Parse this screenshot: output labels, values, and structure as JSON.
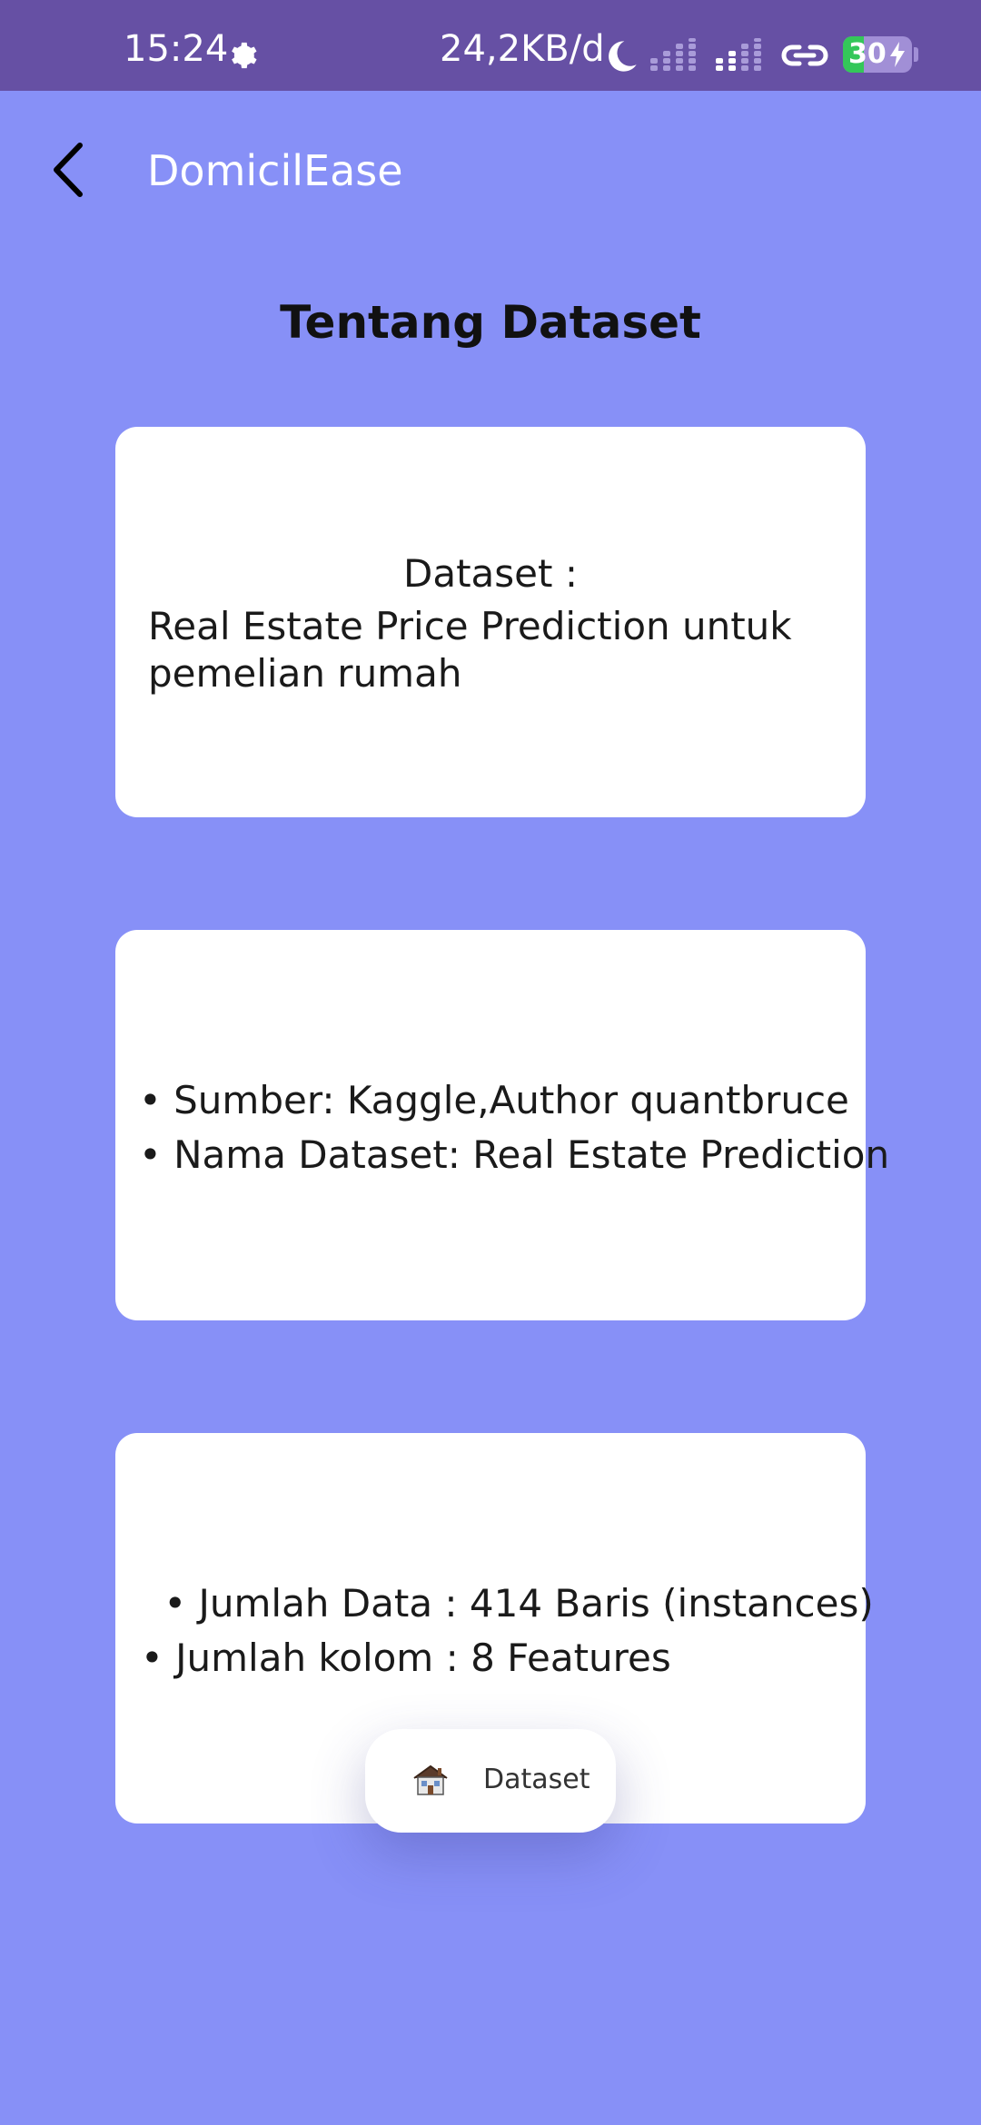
{
  "status_bar": {
    "time": "15:24",
    "net_speed": "24,2KB/d",
    "battery_level": "30",
    "battery_fraction": 0.3,
    "icons": [
      "gear-icon",
      "moon-icon",
      "signal-icon",
      "signal-icon",
      "link-icon",
      "battery-icon",
      "charging-icon"
    ],
    "background": "#6650A4"
  },
  "app_bar": {
    "title": "DomicilEase",
    "back_icon": "chevron-left-icon"
  },
  "page": {
    "title": "Tentang Dataset",
    "background": "#8790F7"
  },
  "cards": [
    {
      "heading": "Dataset :",
      "body": "Real Estate Price Prediction untuk pemelian rumah"
    },
    {
      "lines": [
        "• Sumber: Kaggle,Author quantbruce",
        "• Nama Dataset: Real Estate Prediction"
      ]
    },
    {
      "lines": [
        " • Jumlah Data : 414 Baris (instances)",
        "• Jumlah kolom : 8 Features"
      ]
    }
  ],
  "bottom_nav": {
    "label": "Dataset",
    "icon": "house-icon"
  }
}
